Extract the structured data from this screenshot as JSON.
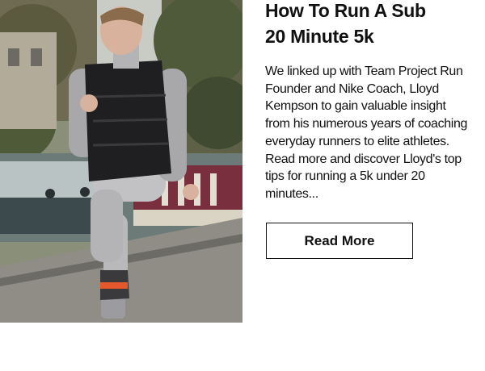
{
  "article": {
    "title_line1": "How To Run A Sub",
    "title_line2": "20 Minute 5k",
    "body": "We linked up with Team Project Run Founder and Nike Coach, Lloyd Kempson to gain valuable insight from his numerous years of coaching everyday runners to elite athletes. Read more and discover Lloyd's top tips for running a 5k under 20 minutes...",
    "cta_label": "Read More"
  },
  "colors": {
    "text": "#111111",
    "background": "#ffffff",
    "button_border": "#111111"
  },
  "hero": {
    "icon": "runner-photo"
  }
}
